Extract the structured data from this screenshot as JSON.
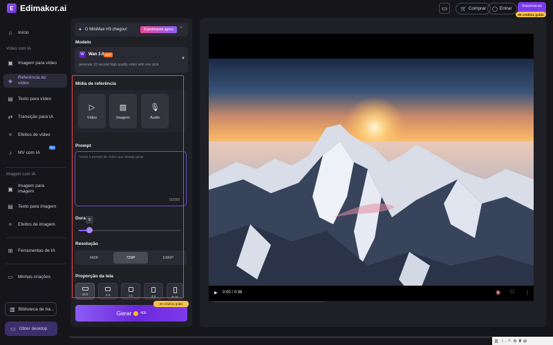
{
  "app": {
    "logo_mark": "E",
    "name": "Edimakor.ai"
  },
  "topbar": {
    "buy_label": "Comprar",
    "login_label": "Entrar",
    "signup_label": "Inscreva-se",
    "credits_label": "90 créditos grátis"
  },
  "sidebar": {
    "home": "Início",
    "section_video": "Vídeo com IA",
    "video_items": [
      "Imagem para vídeo",
      "Referência ao vídeo",
      "Texto para vídeo",
      "Transição para IA",
      "Efeitos de vídeo",
      "MV com IA"
    ],
    "new_badge": "New",
    "section_image": "Imagem com IA",
    "image_items": [
      "Imagem para imagem",
      "Texto para imagem",
      "Efeitos de imagem"
    ],
    "tools": "Ferramentas de IA",
    "creations": "Minhas criações",
    "library": "Biblioteca de ha...",
    "desktop": "Obter desktop"
  },
  "panel": {
    "banner_text": "O MiniMax H3 chegou!",
    "banner_cta": "Experimente agora",
    "model_label": "Modelo",
    "model_name": "Wan 3.0",
    "model_badge": "HOT",
    "model_desc": "generate 10 second high quality video with one click",
    "ref_label": "Mídia de referência",
    "ref_items": [
      "Vídeo",
      "Imagem",
      "Áudio"
    ],
    "prompt_label": "Prompt",
    "prompt_placeholder": "Insira o prompt do vídeo que deseja gerar",
    "prompt_count": "0/2000",
    "duration_label": "Dura",
    "duration_value": "5",
    "resolution_label": "Resolução",
    "resolutions": [
      "480P",
      "720P",
      "1080P"
    ],
    "resolution_selected": "720P",
    "ratio_label": "Proporção da tela",
    "ratios": [
      "16:9",
      "4:3",
      "1:1",
      "3:4",
      "9:16"
    ],
    "generate_label": "Gerar",
    "generate_cost": "400",
    "generate_badge": "30 créditos grátis"
  },
  "player": {
    "time": "0:00 / 0:36"
  },
  "icons": {
    "home": "home-icon",
    "image_to_video": "image-icon",
    "reference": "reference-icon",
    "text_to_video": "text-icon",
    "transition": "transition-icon",
    "effects": "sparkle-icon",
    "mv": "music-icon",
    "tools": "grid-icon",
    "creations": "folder-icon",
    "library": "library-icon",
    "desktop": "monitor-icon"
  },
  "colors": {
    "accent": "#8b5cf6",
    "highlight_border": "#ef4444",
    "coin": "#fbbf24",
    "badge_yellow": "#f6c24a"
  }
}
